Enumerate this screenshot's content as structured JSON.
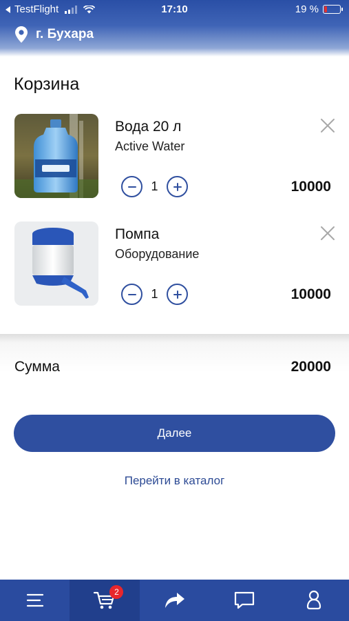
{
  "status_bar": {
    "back_app": "TestFlight",
    "time": "17:10",
    "battery_percent": "19 %",
    "battery_level": 0.19
  },
  "header": {
    "location": "г. Бухара"
  },
  "cart": {
    "title": "Корзина",
    "items": [
      {
        "name": "Вода 20 л",
        "subtitle": "Active Water",
        "quantity": "1",
        "price": "10000",
        "image": "water-bottle-image"
      },
      {
        "name": "Помпа",
        "subtitle": "Оборудование",
        "quantity": "1",
        "price": "10000",
        "image": "water-pump-image"
      }
    ]
  },
  "summary": {
    "label": "Сумма",
    "total": "20000"
  },
  "actions": {
    "next_label": "Далее",
    "catalog_link": "Перейти в каталог"
  },
  "tabbar": {
    "tabs": [
      "menu-icon",
      "cart-icon",
      "share-icon",
      "chat-icon",
      "profile-icon"
    ],
    "active": "cart-icon",
    "cart_badge": "2"
  },
  "colors": {
    "brand": "#2f4fa0",
    "tabbar": "#2a4b9f",
    "badge": "#e8262c",
    "battery_low": "#e03131"
  }
}
